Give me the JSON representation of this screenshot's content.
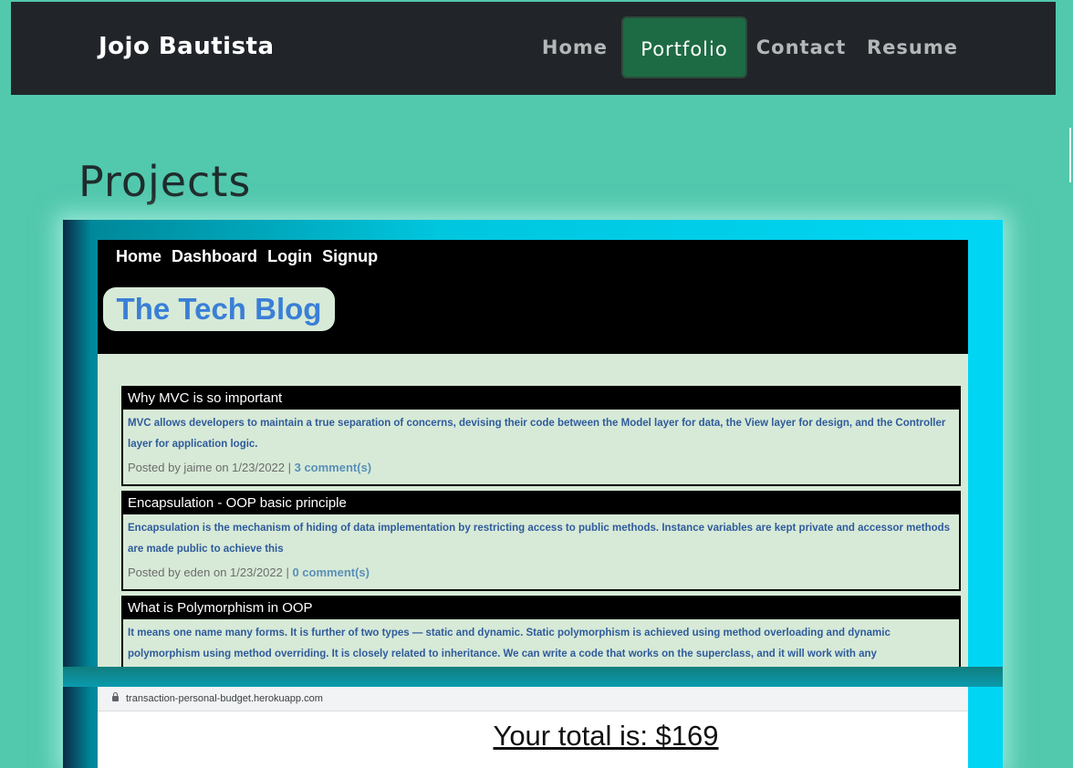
{
  "navbar": {
    "brand": "Jojo Bautista",
    "links": [
      {
        "label": "Home",
        "active": false
      },
      {
        "label": "Portfolio",
        "active": true
      },
      {
        "label": "Contact",
        "active": false
      },
      {
        "label": "Resume",
        "active": false
      }
    ]
  },
  "page": {
    "title": "Projects"
  },
  "project1": {
    "nav": [
      "Home",
      "Dashboard",
      "Login",
      "Signup"
    ],
    "title": "The Tech Blog",
    "posts": [
      {
        "title": "Why MVC is so important",
        "body": "MVC allows developers to maintain a true separation of concerns, devising their code between the Model layer for data, the View layer for design, and the Controller layer for application logic.",
        "meta_prefix": "Posted by jaime on 1/23/2022 | ",
        "comments": "3 comment(s)"
      },
      {
        "title": "Encapsulation - OOP basic principle",
        "body": "Encapsulation is the mechanism of hiding of data implementation by restricting access to public methods. Instance variables are kept private and accessor methods are made public to achieve this",
        "meta_prefix": "Posted by eden on 1/23/2022 | ",
        "comments": "0 comment(s)"
      },
      {
        "title": "What is Polymorphism in OOP",
        "body": "It means one name many forms. It is further of two types — static and dynamic. Static polymorphism is achieved using method overloading and dynamic polymorphism using method overriding. It is closely related to inheritance. We can write a code that works on the superclass, and it will work with any",
        "meta_prefix": "",
        "comments": ""
      }
    ]
  },
  "project2": {
    "url": "transaction-personal-budget.herokuapp.com",
    "total": "Your total is: $169"
  },
  "colors": {
    "background": "#52c8ad",
    "navbar": "#212529",
    "active_nav": "#1d6b44",
    "blog_title": "#3a7fd6"
  }
}
